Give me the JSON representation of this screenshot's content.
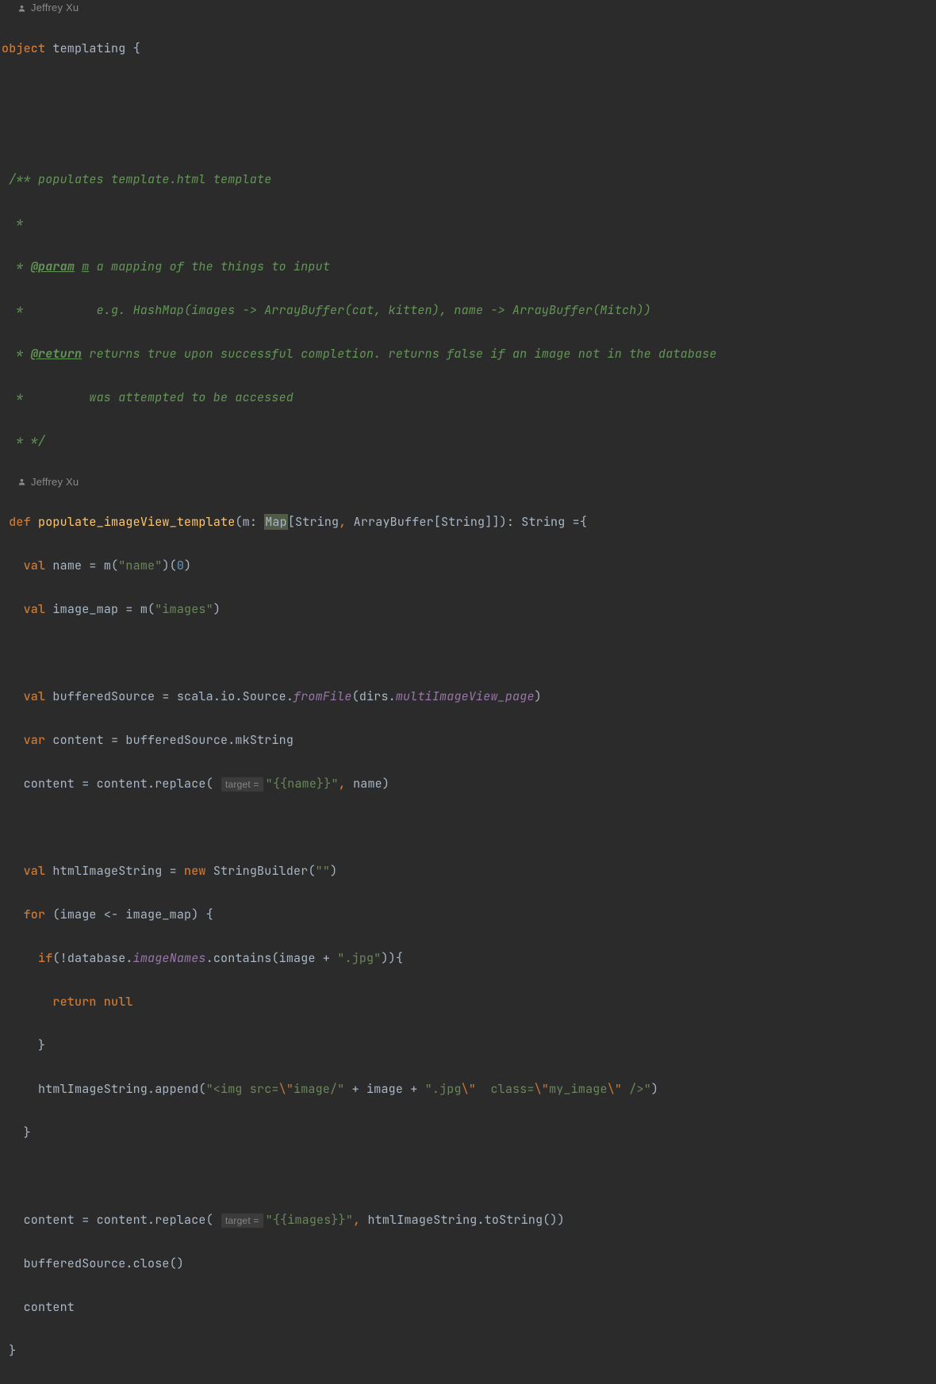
{
  "authors": {
    "line1": "Jeffrey Xu",
    "line2": "Jeffrey Xu"
  },
  "hints": {
    "target": "target ="
  },
  "tokens": {
    "l1": {
      "kw": "object",
      "name": " templating {"
    },
    "doc": {
      "d1": " /** populates template.html template",
      "d2": "  *",
      "d3a": "  * ",
      "d3tag": "@param",
      "d3sp": " ",
      "d3var": "m",
      "d3rest": " a mapping of the things to input",
      "d4": "  *          e.g. HashMap(images -> ArrayBuffer(cat, kitten), name -> ArrayBuffer(Mitch))",
      "d5a": "  * ",
      "d5tag": "@return",
      "d5rest": " returns true upon successful completion. returns false if an image not in the database",
      "d6": "  *         was attempted to be accessed",
      "d7": "  * */"
    },
    "sig": {
      "pre": " ",
      "def": "def",
      "sp": " ",
      "fn": "populate_imageView_template",
      "open": "(m: ",
      "map": "Map",
      "mid": "[String",
      "comma": ",",
      "rest": " ArrayBuffer[String]]): String ={"
    },
    "b1": {
      "pre": "   ",
      "val": "val",
      "mid": " name = m(",
      "str": "\"name\"",
      "close": ")(",
      "num": "0",
      "end": ")"
    },
    "b2": {
      "pre": "   ",
      "val": "val",
      "mid": " image_map = m(",
      "str": "\"images\"",
      "end": ")"
    },
    "b3": {
      "pre": "   ",
      "val": "val",
      "mid": " bufferedSource = scala.io.Source.",
      "meth": "fromFile",
      "open": "(dirs.",
      "field": "multiImageView_page",
      "end": ")"
    },
    "b4": {
      "pre": "   ",
      "var": "var",
      "rest": " content = bufferedSource.mkString"
    },
    "b5": {
      "pre": "   content = content.replace( ",
      "str": "\"{{name}}\"",
      "comma": ",",
      "rest": " name)"
    },
    "b6": {
      "pre": "   ",
      "val": "val",
      "mid": " htmlImageString = ",
      "new": "new",
      "rest": " StringBuilder(",
      "str": "\"\"",
      "end": ")"
    },
    "b7": {
      "pre": "   ",
      "for": "for",
      "rest": " (image <- image_map) {"
    },
    "b8": {
      "pre": "     ",
      "if": "if",
      "mid": "(!database.",
      "field": "imageNames",
      "after": ".contains(image + ",
      "str": "\".jpg\"",
      "end": ")){"
    },
    "b9": {
      "pre": "       ",
      "ret": "return null"
    },
    "b10": {
      "pre": "     }"
    },
    "b11": {
      "pre": "     htmlImageString.append(",
      "s1": "\"<img src=",
      "e1": "\\\"",
      "s2": "image/\"",
      "p1": " + image + ",
      "s3": "\".jpg",
      "e2": "\\\"",
      "s4": "  class=",
      "e3": "\\\"",
      "s5": "my_image",
      "e4": "\\\"",
      "s6": " />\"",
      "end": ")"
    },
    "b12": {
      "pre": "   }"
    },
    "b13": {
      "pre": "   content = content.replace( ",
      "str": "\"{{images}}\"",
      "comma": ",",
      "rest": " htmlImageString.toString())"
    },
    "b14": {
      "pre": "   bufferedSource.close()"
    },
    "b15": {
      "pre": "   content"
    },
    "b16": {
      "pre": " }"
    }
  }
}
